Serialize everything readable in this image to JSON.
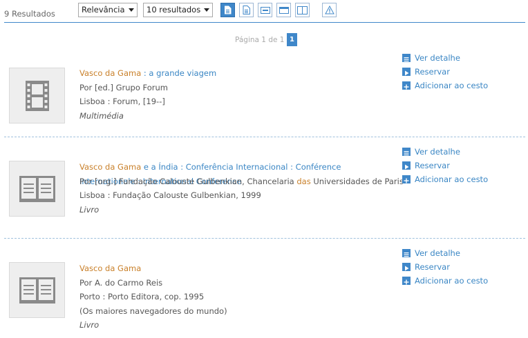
{
  "toolbar": {
    "result_count": "9 Resultados",
    "order_select": "Relevância",
    "size_select": "10 resultados"
  },
  "pagination": {
    "text": "Página 1 de 1",
    "current": "1"
  },
  "actions": {
    "details": "Ver detalhe",
    "reserve": "Reservar",
    "basket": "Adicionar ao cesto"
  },
  "results": [
    {
      "icon": "film-icon",
      "title_highlight": "Vasco da Gama",
      "title_rest": " : a grande viagem",
      "author": "Por [ed.] Grupo Forum",
      "publication": "Lisboa : Forum, [19--]",
      "type": "Multimédia"
    },
    {
      "icon": "book-icon",
      "title_highlight": "Vasco da Gama",
      "title_rest": " e a Índia : Conferência Internacional : Conférence Internationale : International Conference",
      "author_part1": "Por [org.] Fundação Calouste Gulbenkian, Chancelaria ",
      "author_highlight": "das",
      "author_part2": " Universidades de Paris",
      "publication": "Lisboa : Fundação Calouste Gulbenkian, 1999",
      "type": "Livro"
    },
    {
      "icon": "book-icon",
      "title_highlight": "Vasco da Gama",
      "title_rest": "",
      "author": "Por A. do Carmo Reis",
      "publication": "Porto : Porto Editora, cop. 1995",
      "series": "(Os maiores navegadores do mundo)",
      "type": "Livro"
    }
  ]
}
